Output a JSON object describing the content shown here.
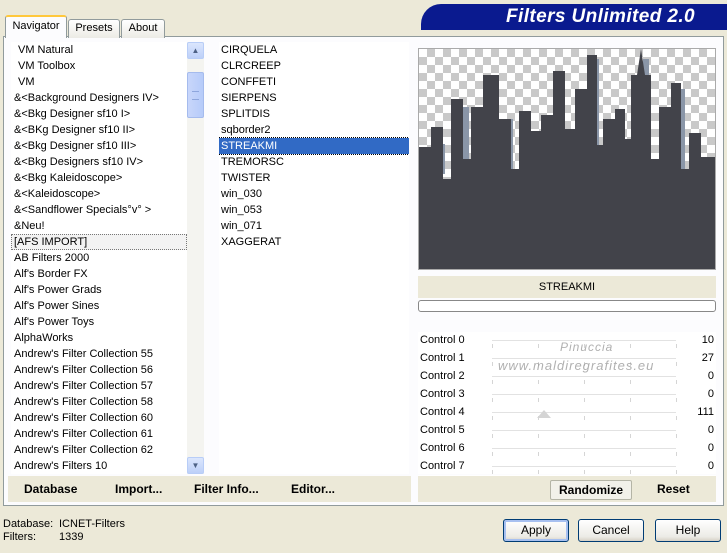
{
  "tabs": [
    "Navigator",
    "Presets",
    "About"
  ],
  "banner_title": "Filters Unlimited 2.0",
  "categories": [
    "VM Natural",
    "VM Toolbox",
    "VM",
    "&<Background Designers IV>",
    "&<Bkg Designer sf10 I>",
    "&<BKg Designer sf10 II>",
    "&<Bkg Designer sf10 III>",
    "&<Bkg Designers sf10 IV>",
    "&<Bkg Kaleidoscope>",
    "&<Kaleidoscope>",
    "&<Sandflower Specials°v° >",
    "&Neu!",
    "[AFS IMPORT]",
    "AB Filters 2000",
    "Alf's Border FX",
    "Alf's Power Grads",
    "Alf's Power Sines",
    "Alf's Power Toys",
    "AlphaWorks",
    "Andrew's Filter Collection 55",
    "Andrew's Filter Collection 56",
    "Andrew's Filter Collection 57",
    "Andrew's Filter Collection 58",
    "Andrew's Filter Collection 60",
    "Andrew's Filter Collection 61",
    "Andrew's Filter Collection 62",
    "Andrew's Filters 10"
  ],
  "categories_framed_index": 12,
  "filters": [
    "CIRQUELA",
    "CLRCREEP",
    "CONFFETI",
    "SIERPENS",
    "SPLITDIS",
    "sqborder2",
    "STREAKMI",
    "TREMORSC",
    "TWISTER",
    "win_030",
    "win_053",
    "win_071",
    "XAGGERAT"
  ],
  "filters_selected_index": 6,
  "selected_filter_name": "STREAKMI",
  "controls": [
    {
      "label": "Control 0",
      "value": "10"
    },
    {
      "label": "Control 1",
      "value": "27"
    },
    {
      "label": "Control 2",
      "value": "0"
    },
    {
      "label": "Control 3",
      "value": "0"
    },
    {
      "label": "Control 4",
      "value": "111"
    },
    {
      "label": "Control 5",
      "value": "0"
    },
    {
      "label": "Control 6",
      "value": "0"
    },
    {
      "label": "Control 7",
      "value": "0"
    }
  ],
  "watermark": {
    "line1": "Pinuccia",
    "line2": "www.maldiregrafites.eu"
  },
  "toolbar_left": [
    "Database",
    "Import...",
    "Filter Info...",
    "Editor..."
  ],
  "toolbar_right": [
    "Randomize",
    "Reset"
  ],
  "status": {
    "database_label": "Database:",
    "database_value": "ICNET-Filters",
    "filters_label": "Filters:",
    "filters_value": "1339"
  },
  "dialog_buttons": {
    "apply": "Apply",
    "cancel": "Cancel",
    "help": "Help"
  },
  "colors": {
    "selection": "#316ac5",
    "banner": "#0a1a8f",
    "skyline": "#42434a",
    "skyline_edge": "#8a96a8"
  }
}
